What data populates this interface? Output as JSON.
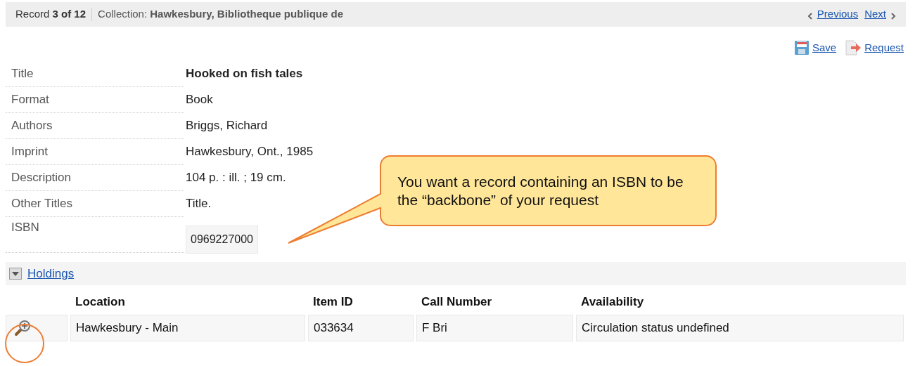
{
  "record_bar": {
    "position": "Record **3 of 12**",
    "collection": "Collection: **Hawkesbury, Bibliotheque publique de**",
    "previous": "Previous",
    "next": "Next"
  },
  "actions": [
    "Save",
    "Request"
  ],
  "fields": [
    {
      "label": "Title",
      "value": "Hooked on fish tales",
      "kind": "bold"
    },
    {
      "label": "Format",
      "value": "Book",
      "kind": "plain"
    },
    {
      "label": "Authors",
      "value": "Briggs, Richard",
      "kind": "plain"
    },
    {
      "label": "Imprint",
      "value": "Hawkesbury, Ont., 1985",
      "kind": "plain"
    },
    {
      "label": "Description",
      "value": "104 p. : ill. ; 19 cm.",
      "kind": "plain"
    },
    {
      "label": "Other Titles",
      "value": "Title.",
      "kind": "plain"
    },
    {
      "label": "ISBN",
      "value": "0969227000",
      "kind": "boxed"
    }
  ],
  "holdings": {
    "title": "Holdings",
    "expanded": true,
    "columns": [
      "Location",
      "Item ID",
      "Call Number",
      "Availability"
    ],
    "rows": [
      {
        "cells": [
          "Hawkesbury - Main",
          "033634",
          "F Bri",
          "Circulation status undefined"
        ]
      }
    ]
  },
  "callout": {
    "text": "You want a record containing an ISBN to be the “backbone” of your request"
  }
}
